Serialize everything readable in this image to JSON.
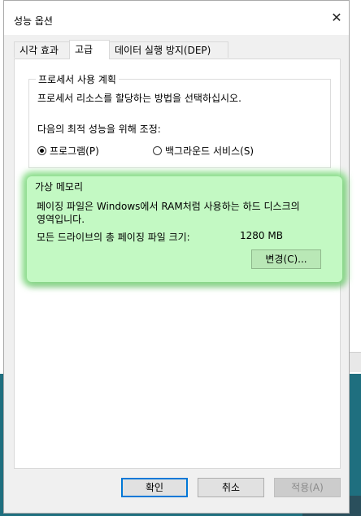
{
  "dialog": {
    "title": "성능 옵션",
    "close_symbol": "✕"
  },
  "tabs": [
    {
      "label": "시각 효과",
      "active": false
    },
    {
      "label": "고급",
      "active": true
    },
    {
      "label": "데이터 실행 방지(DEP)",
      "active": false
    }
  ],
  "processor": {
    "group_title": "프로세서 사용 계획",
    "description": "프로세서 리소스를 할당하는 방법을 선택하십시오.",
    "adjust_label": "다음의 최적 성능을 위해 조정:",
    "options": [
      {
        "label": "프로그램(P)",
        "selected": true
      },
      {
        "label": "백그라운드 서비스(S)",
        "selected": false
      }
    ]
  },
  "virtual_memory": {
    "group_title": "가상 메모리",
    "description_line1": "페이징 파일은 Windows에서 RAM처럼 사용하는 하드 디스크의",
    "description_line2": "영역입니다.",
    "total_label": "모든 드라이브의 총 페이징 파일 크기:",
    "total_value": "1280 MB",
    "change_button": "변경(C)...",
    "highlight_color": "#c3f9c3"
  },
  "footer": {
    "ok": "확인",
    "cancel": "취소",
    "apply": "적용(A)"
  },
  "colors": {
    "accent": "#0078d7",
    "desktop": "#1f6f7f"
  }
}
